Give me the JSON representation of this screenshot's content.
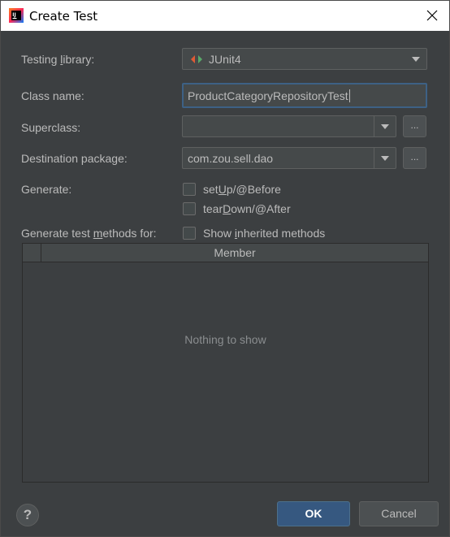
{
  "window": {
    "title": "Create Test"
  },
  "form": {
    "testing_library": {
      "label_pre": "Testing ",
      "label_u": "l",
      "label_post": "ibrary:",
      "value": "JUnit4"
    },
    "class_name": {
      "label": "Class name:",
      "value": "ProductCategoryRepositoryTest"
    },
    "superclass": {
      "label": "Superclass:",
      "value": "",
      "browse_label": "..."
    },
    "destination_package": {
      "label": "Destination package:",
      "value": "com.zou.sell.dao",
      "browse_label": "..."
    },
    "generate": {
      "label": "Generate:",
      "setup": {
        "pre": "set",
        "u": "U",
        "post": "p/@Before",
        "checked": false
      },
      "teardown": {
        "pre": "tear",
        "u": "D",
        "post": "own/@After",
        "checked": false
      }
    },
    "generate_methods": {
      "label_pre": "Generate test ",
      "label_u": "m",
      "label_post": "ethods for:",
      "show_inherited": {
        "pre": "Show ",
        "u": "i",
        "post": "nherited methods",
        "checked": false
      }
    }
  },
  "table": {
    "column_member": "Member",
    "empty_text": "Nothing to show"
  },
  "footer": {
    "help_label": "?",
    "ok_label": "OK",
    "cancel_label": "Cancel"
  }
}
